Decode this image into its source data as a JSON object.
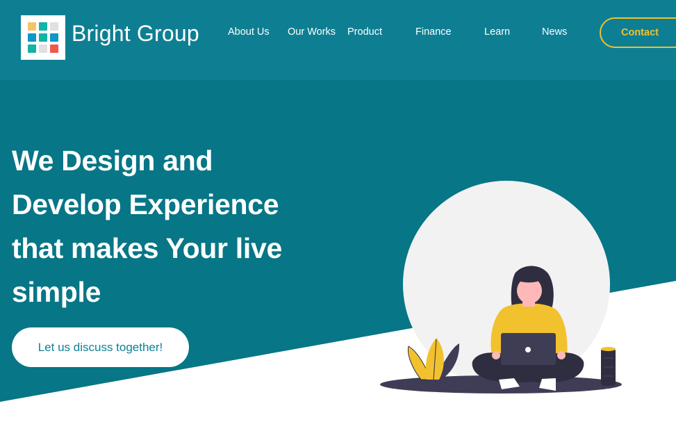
{
  "header": {
    "brand": "Bright Group",
    "nav": [
      {
        "id": "about",
        "label": "About Us"
      },
      {
        "id": "works",
        "label": "Our Works"
      },
      {
        "id": "product",
        "label": "Product"
      },
      {
        "id": "finance",
        "label": "Finance"
      },
      {
        "id": "learn",
        "label": "Learn"
      },
      {
        "id": "news",
        "label": "News"
      }
    ],
    "contact_label": "Contact"
  },
  "hero": {
    "headline_lines": [
      "We Design and",
      "Develop Experience",
      "that makes Your live",
      "simple"
    ],
    "cta_label": "Let us discuss together!"
  },
  "colors": {
    "header_bg": "#0e7f93",
    "hero_bg": "#077686",
    "accent_yellow": "#f2c12e",
    "logo_colors": [
      "#f4c36a",
      "#13b3a6",
      "#e0e0e0",
      "#1196c9",
      "#13b3a6",
      "#1196c9",
      "#13b3a6",
      "#e0e0e0",
      "#ef5a4c"
    ]
  },
  "icons": {
    "logo": "grid-logo-icon",
    "illustration": "woman-with-laptop-illustration"
  }
}
